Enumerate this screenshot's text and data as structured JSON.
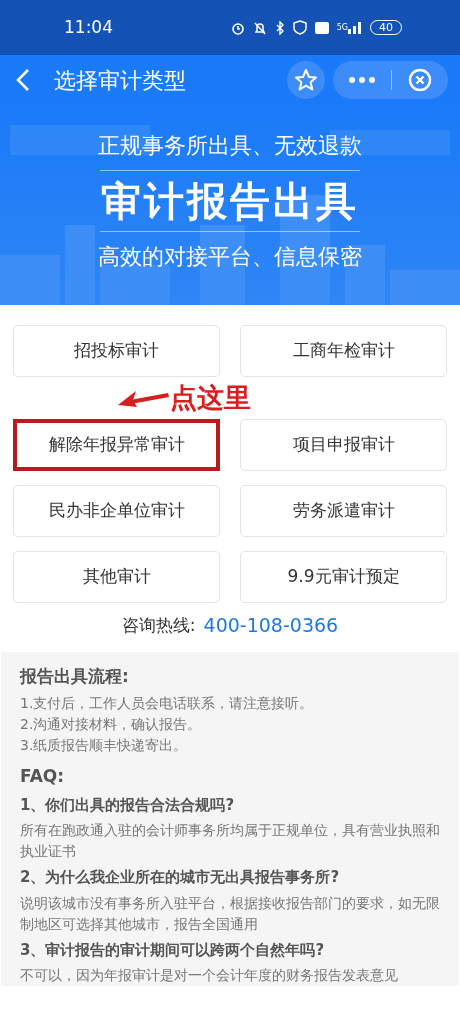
{
  "status_bar": {
    "time": "11:04",
    "network": "5G",
    "battery": "40"
  },
  "header": {
    "title": "选择审计类型"
  },
  "banner": {
    "top_line": "正规事务所出具、无效退款",
    "headline": "审计报告出具",
    "bottom_line": "高效的对接平台、信息保密"
  },
  "audit_types": [
    {
      "label": "招投标审计",
      "highlighted": false
    },
    {
      "label": "工商年检审计",
      "highlighted": false
    },
    {
      "label": "解除年报异常审计",
      "highlighted": true
    },
    {
      "label": "项目申报审计",
      "highlighted": false
    },
    {
      "label": "民办非企单位审计",
      "highlighted": false
    },
    {
      "label": "劳务派遣审计",
      "highlighted": false
    },
    {
      "label": "其他审计",
      "highlighted": false
    },
    {
      "label": "9.9元审计预定",
      "highlighted": false
    }
  ],
  "annotation": {
    "text": "点这里"
  },
  "hotline": {
    "label": "咨询热线:",
    "number": "400-108-0366"
  },
  "info": {
    "process_title": "报告出具流程:",
    "steps": [
      "1.支付后，工作人员会电话联系，请注意接听。",
      "2.沟通对接材料，确认报告。",
      "3.纸质报告顺丰快递寄出。"
    ],
    "faq_title": "FAQ:",
    "faqs": [
      {
        "question": "1、你们出具的报告合法合规吗?",
        "answer": "所有在跑政通入驻的会计师事务所均属于正规单位，具有营业执照和执业证书"
      },
      {
        "question": "2、为什么我企业所在的城市无出具报告事务所?",
        "answer": "说明该城市没有事务所入驻平台，根据接收报告部门的要求，如无限制地区可选择其他城市，报告全国通用"
      },
      {
        "question": "3、审计报告的审计期间可以跨两个自然年吗?",
        "answer": "不可以，因为年报审计是对一个会计年度的财务报告发表意见"
      }
    ]
  }
}
